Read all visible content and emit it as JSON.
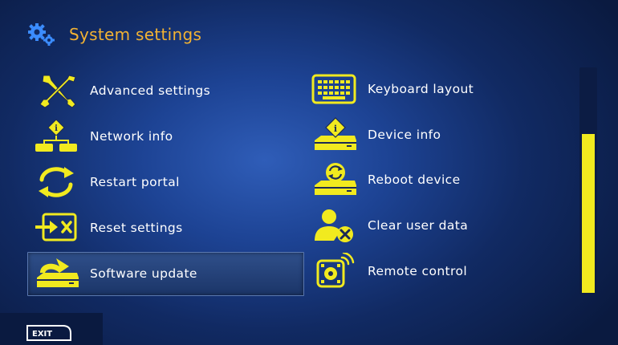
{
  "header": {
    "title": "System settings"
  },
  "menu": {
    "left": [
      {
        "label": "Advanced settings",
        "icon": "wrench-screwdriver-icon"
      },
      {
        "label": "Network info",
        "icon": "network-info-icon"
      },
      {
        "label": "Restart portal",
        "icon": "restart-arrows-icon"
      },
      {
        "label": "Reset settings",
        "icon": "reset-icon"
      },
      {
        "label": "Software update",
        "icon": "software-update-icon"
      }
    ],
    "right": [
      {
        "label": "Keyboard layout",
        "icon": "keyboard-icon"
      },
      {
        "label": "Device info",
        "icon": "device-info-icon"
      },
      {
        "label": "Reboot device",
        "icon": "reboot-device-icon"
      },
      {
        "label": "Clear user data",
        "icon": "clear-user-icon"
      },
      {
        "label": "Remote control",
        "icon": "remote-control-icon"
      }
    ],
    "selected": "Software update"
  },
  "scrollbar": {
    "position_fraction": 0.71
  },
  "footer": {
    "exit_label": "EXIT"
  },
  "colors": {
    "accent": "#f2b233",
    "icon": "#f1ea1f",
    "text": "#ffffff"
  }
}
